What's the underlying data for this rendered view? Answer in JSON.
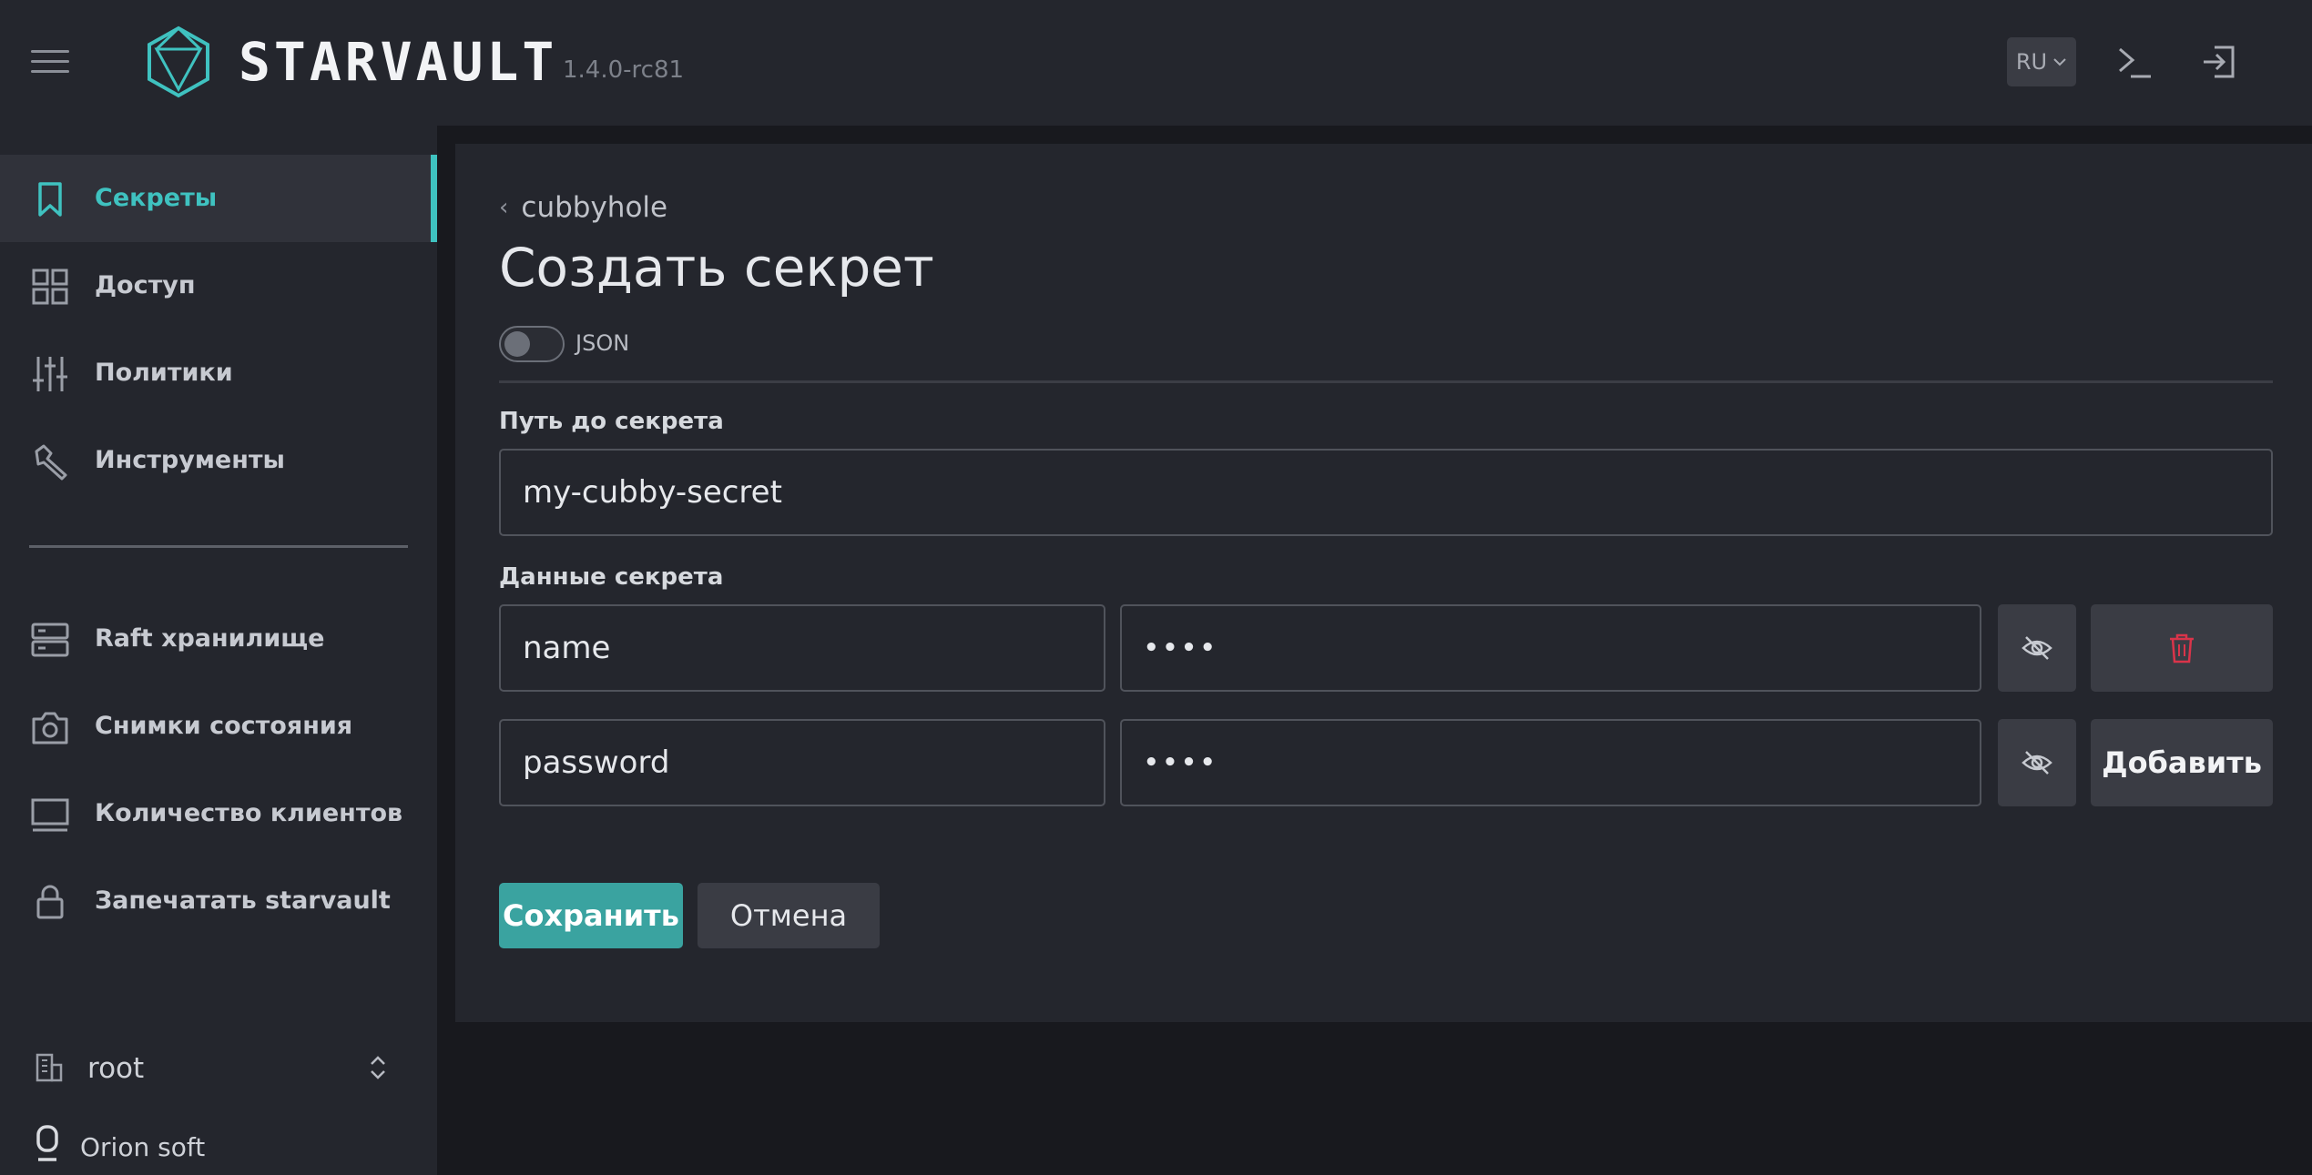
{
  "app": {
    "brand": "STARVAULT",
    "version": "1.4.0-rc81",
    "language": "RU"
  },
  "colors": {
    "accent": "#3fc2c0",
    "primary_button": "#3aa3a0",
    "danger": "#d9344a",
    "surface": "#24262d",
    "background": "#18191e"
  },
  "sidebar": {
    "items": [
      {
        "label": "Секреты",
        "icon": "bookmark-icon",
        "active": true
      },
      {
        "label": "Доступ",
        "icon": "grid-icon",
        "active": false
      },
      {
        "label": "Политики",
        "icon": "sliders-icon",
        "active": false
      },
      {
        "label": "Инструменты",
        "icon": "tools-icon",
        "active": false
      },
      {
        "label": "Raft хранилище",
        "icon": "server-icon",
        "active": false
      },
      {
        "label": "Снимки состояния",
        "icon": "camera-icon",
        "active": false
      },
      {
        "label": "Количество клиентов",
        "icon": "monitor-icon",
        "active": false
      },
      {
        "label": "Запечатать starvault",
        "icon": "lock-icon",
        "active": false
      }
    ],
    "namespace": "root",
    "organization": "Orion soft"
  },
  "main": {
    "breadcrumb": "cubbyhole",
    "title": "Создать секрет",
    "json_toggle_label": "JSON",
    "json_toggle_on": false,
    "path_label": "Путь до секрета",
    "path_value": "my-cubby-secret",
    "data_label": "Данные секрета",
    "rows": [
      {
        "key": "name",
        "value_masked": "••••",
        "action": "delete"
      },
      {
        "key": "password",
        "value_masked": "••••",
        "action": "add"
      }
    ],
    "add_label": "Добавить",
    "save_label": "Сохранить",
    "cancel_label": "Отмена"
  }
}
